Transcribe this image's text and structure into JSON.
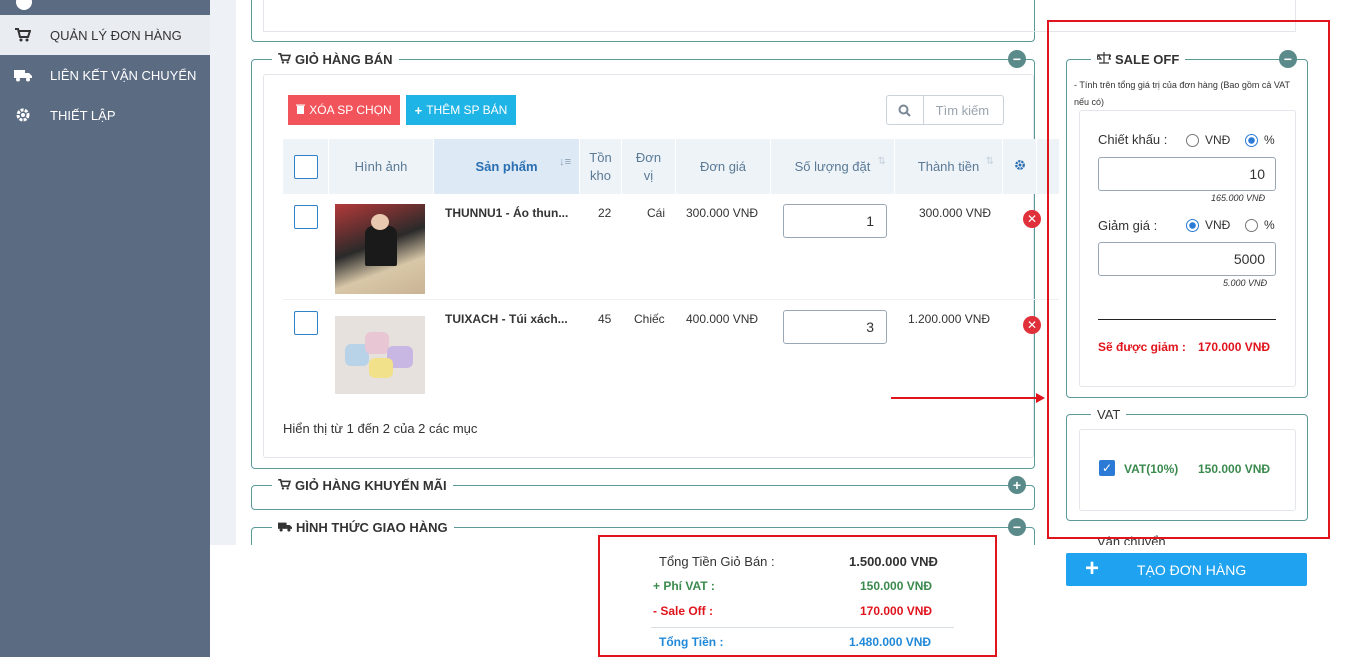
{
  "sidebar": {
    "items": [
      {
        "label": "QUẢN LÝ ĐƠN HÀNG",
        "icon": "cart-icon"
      },
      {
        "label": "LIÊN KẾT VẬN CHUYỂN",
        "icon": "truck-icon"
      },
      {
        "label": "THIẾT LẬP",
        "icon": "gear-icon"
      }
    ]
  },
  "cart": {
    "title": "GIỎ HÀNG BÁN",
    "delete_selected": "XÓA SP CHỌN",
    "add_product": "THÊM SP BÁN",
    "search_placeholder": "Tìm kiếm",
    "headers": {
      "image": "Hình ảnh",
      "product": "Sản phẩm",
      "stock_1": "Tồn",
      "stock_2": "kho",
      "unit_1": "Đơn",
      "unit_2": "vị",
      "price": "Đơn giá",
      "qty": "Số lượng đặt",
      "total": "Thành tiền"
    },
    "rows": [
      {
        "name": "THUNNU1 - Áo thun...",
        "stock": "22",
        "unit": "Cái",
        "price": "300.000 VNĐ",
        "qty": "1",
        "total": "300.000 VNĐ"
      },
      {
        "name": "TUIXACH - Túi xách...",
        "stock": "45",
        "unit": "Chiếc",
        "price": "400.000 VNĐ",
        "qty": "3",
        "total": "1.200.000 VNĐ"
      }
    ],
    "footer_info": "Hiển thị từ 1 đến 2 của 2 các mục"
  },
  "promo_cart": {
    "title": "GIỎ HÀNG KHUYẾN MÃI"
  },
  "shipping": {
    "title": "HÌNH THỨC GIAO HÀNG"
  },
  "sale_off": {
    "title": "SALE OFF",
    "note": "- Tính trên tổng giá trị của đơn hàng (Bao gồm cả VAT nếu có)",
    "discount_label": "Chiết khấu :",
    "discount_opt_vnd": "VNĐ",
    "discount_opt_pct": "%",
    "discount_value": "10",
    "discount_sub": "165.000 VNĐ",
    "reduce_label": "Giảm giá :",
    "reduce_opt_vnd": "VNĐ",
    "reduce_opt_pct": "%",
    "reduce_value": "5000",
    "reduce_sub": "5.000 VNĐ",
    "result_label": "Sẽ được giảm :",
    "result_value": "170.000 VNĐ"
  },
  "vat": {
    "title": "VAT",
    "label": "VAT(10%)",
    "value": "150.000 VNĐ"
  },
  "shipping_side": {
    "title": "Vận chuyển"
  },
  "summary": {
    "cart_total_label": "Tổng Tiền Giỏ Bán :",
    "cart_total_value": "1.500.000 VNĐ",
    "vat_label": "+ Phí VAT :",
    "vat_value": "150.000 VNĐ",
    "sale_label": "- Sale Off :",
    "sale_value": "170.000 VNĐ",
    "grand_label": "Tổng Tiền :",
    "grand_value": "1.480.000 VNĐ"
  },
  "create_order": "TẠO ĐƠN HÀNG",
  "colors": {
    "sidebar": "#5b6b82",
    "accent_blue": "#1fa2f0",
    "annotation_red": "#e0141c",
    "green": "#3a8a4e",
    "red_text": "#e0141c"
  }
}
